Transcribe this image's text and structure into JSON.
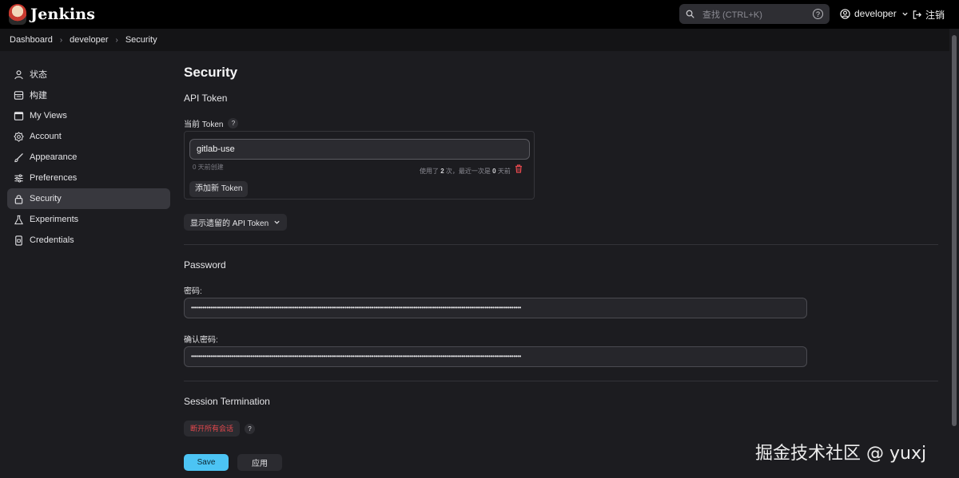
{
  "header": {
    "app_name": "Jenkins",
    "search_placeholder": "查找 (CTRL+K)",
    "search_help": "?",
    "user_name": "developer",
    "logout_label": "注销"
  },
  "breadcrumb": [
    "Dashboard",
    "developer",
    "Security"
  ],
  "sidebar": {
    "items": [
      {
        "label": "状态",
        "icon": "user-icon",
        "active": false
      },
      {
        "label": "构建",
        "icon": "builds-icon",
        "active": false
      },
      {
        "label": "My Views",
        "icon": "window-icon",
        "active": false
      },
      {
        "label": "Account",
        "icon": "gear-icon",
        "active": false
      },
      {
        "label": "Appearance",
        "icon": "brush-icon",
        "active": false
      },
      {
        "label": "Preferences",
        "icon": "sliders-icon",
        "active": false
      },
      {
        "label": "Security",
        "icon": "lock-icon",
        "active": true
      },
      {
        "label": "Experiments",
        "icon": "flask-icon",
        "active": false
      },
      {
        "label": "Credentials",
        "icon": "phone-icon",
        "active": false
      }
    ]
  },
  "main": {
    "title": "Security",
    "api_token": {
      "section_title": "API Token",
      "current_label": "当前 Token",
      "help": "?",
      "token_name": "gitlab-use",
      "created": "0 天前创建",
      "usage_prefix": "使用了",
      "usage_count": "2",
      "usage_mid": "次，最近一次是",
      "usage_days": "0",
      "usage_suffix": "天前",
      "add_button": "添加新 Token",
      "legacy_button": "显示遗留的 API Token"
    },
    "password": {
      "section_title": "Password",
      "password_label": "密码:",
      "password_value": "••••••••••••••••••••••••••••••••••••••••••••••••••••••••••••••••••••••••••••••••••••••••••••••••••••••••••••••••••••••••••••••••••••••••••••••••••••••••••••••••••••••••••••",
      "confirm_label": "确认密码:",
      "confirm_value": "••••••••••••••••••••••••••••••••••••••••••••••••••••••••••••••••••••••••••••••••••••••••••••••••••••••••••••••••••••••••••••••••••••••••••••••••••••••••••••••••••••••••••••"
    },
    "session": {
      "section_title": "Session Termination",
      "terminate_button": "断开所有会话",
      "help": "?"
    },
    "save_button": "Save",
    "apply_button": "应用"
  },
  "watermark": "掘金技术社区 @ yuxj",
  "colors": {
    "accent": "#4cc4f4",
    "danger": "#e5484d",
    "background": "#1c1c20",
    "header": "#000000"
  }
}
